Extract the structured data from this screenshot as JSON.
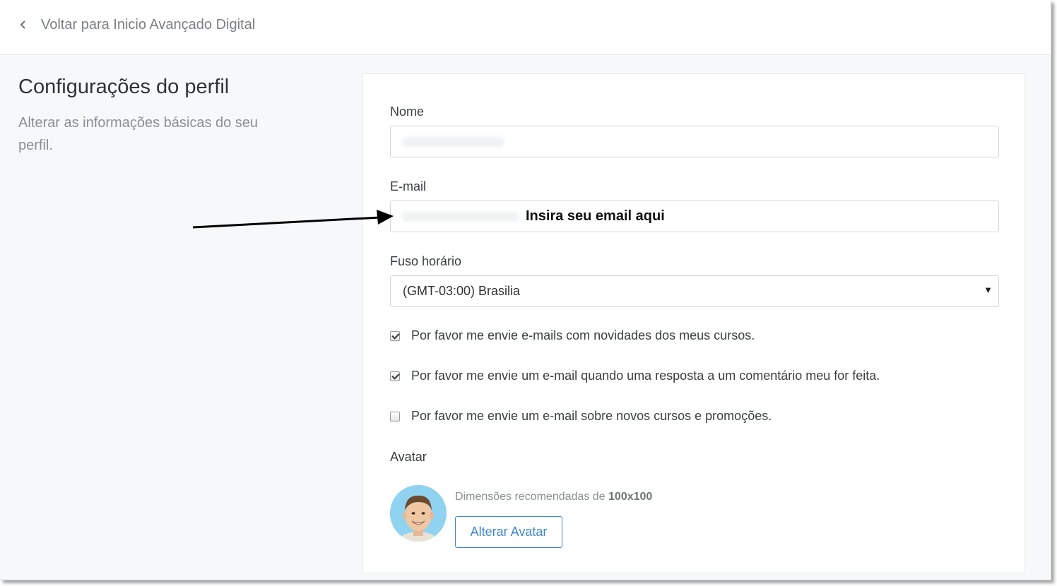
{
  "header": {
    "back_label": "Voltar para Inicio Avançado Digital"
  },
  "intro": {
    "title": "Configurações do perfil",
    "subtitle": "Alterar as informações básicas do seu perfil."
  },
  "form": {
    "name_label": "Nome",
    "name_value": "",
    "email_label": "E-mail",
    "email_value": "",
    "email_annotation": "Insira seu email aqui",
    "timezone_label": "Fuso horário",
    "timezone_value": "(GMT-03:00) Brasilia",
    "checkboxes": [
      {
        "label": "Por favor me envie e-mails com novidades dos meus cursos.",
        "checked": true
      },
      {
        "label": "Por favor me envie um e-mail quando uma resposta a um comentário meu for feita.",
        "checked": true
      },
      {
        "label": "Por favor me envie um e-mail sobre novos cursos e promoções.",
        "checked": false
      }
    ],
    "avatar_label": "Avatar",
    "avatar_hint_prefix": "Dimensões recomendadas de ",
    "avatar_hint_size": "100x100",
    "avatar_button": "Alterar Avatar"
  },
  "colors": {
    "accent": "#3f86d1",
    "page_bg": "#f7f8fa",
    "avatar_bg": "#8fd3f0"
  }
}
